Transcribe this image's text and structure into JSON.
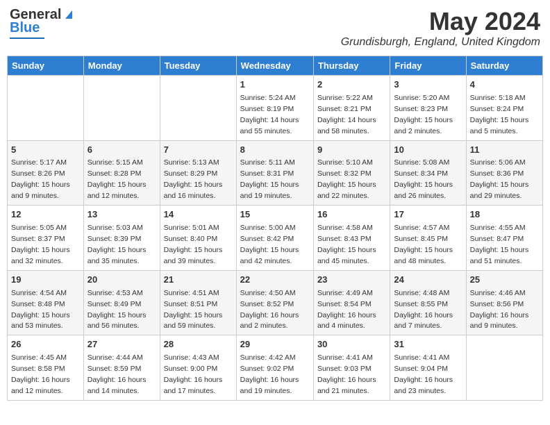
{
  "header": {
    "logo_line1": "General",
    "logo_line2": "Blue",
    "month_year": "May 2024",
    "location": "Grundisburgh, England, United Kingdom"
  },
  "days_of_week": [
    "Sunday",
    "Monday",
    "Tuesday",
    "Wednesday",
    "Thursday",
    "Friday",
    "Saturday"
  ],
  "weeks": [
    [
      {
        "day": "",
        "text": ""
      },
      {
        "day": "",
        "text": ""
      },
      {
        "day": "",
        "text": ""
      },
      {
        "day": "1",
        "text": "Sunrise: 5:24 AM\nSunset: 8:19 PM\nDaylight: 14 hours and 55 minutes."
      },
      {
        "day": "2",
        "text": "Sunrise: 5:22 AM\nSunset: 8:21 PM\nDaylight: 14 hours and 58 minutes."
      },
      {
        "day": "3",
        "text": "Sunrise: 5:20 AM\nSunset: 8:23 PM\nDaylight: 15 hours and 2 minutes."
      },
      {
        "day": "4",
        "text": "Sunrise: 5:18 AM\nSunset: 8:24 PM\nDaylight: 15 hours and 5 minutes."
      }
    ],
    [
      {
        "day": "5",
        "text": "Sunrise: 5:17 AM\nSunset: 8:26 PM\nDaylight: 15 hours and 9 minutes."
      },
      {
        "day": "6",
        "text": "Sunrise: 5:15 AM\nSunset: 8:28 PM\nDaylight: 15 hours and 12 minutes."
      },
      {
        "day": "7",
        "text": "Sunrise: 5:13 AM\nSunset: 8:29 PM\nDaylight: 15 hours and 16 minutes."
      },
      {
        "day": "8",
        "text": "Sunrise: 5:11 AM\nSunset: 8:31 PM\nDaylight: 15 hours and 19 minutes."
      },
      {
        "day": "9",
        "text": "Sunrise: 5:10 AM\nSunset: 8:32 PM\nDaylight: 15 hours and 22 minutes."
      },
      {
        "day": "10",
        "text": "Sunrise: 5:08 AM\nSunset: 8:34 PM\nDaylight: 15 hours and 26 minutes."
      },
      {
        "day": "11",
        "text": "Sunrise: 5:06 AM\nSunset: 8:36 PM\nDaylight: 15 hours and 29 minutes."
      }
    ],
    [
      {
        "day": "12",
        "text": "Sunrise: 5:05 AM\nSunset: 8:37 PM\nDaylight: 15 hours and 32 minutes."
      },
      {
        "day": "13",
        "text": "Sunrise: 5:03 AM\nSunset: 8:39 PM\nDaylight: 15 hours and 35 minutes."
      },
      {
        "day": "14",
        "text": "Sunrise: 5:01 AM\nSunset: 8:40 PM\nDaylight: 15 hours and 39 minutes."
      },
      {
        "day": "15",
        "text": "Sunrise: 5:00 AM\nSunset: 8:42 PM\nDaylight: 15 hours and 42 minutes."
      },
      {
        "day": "16",
        "text": "Sunrise: 4:58 AM\nSunset: 8:43 PM\nDaylight: 15 hours and 45 minutes."
      },
      {
        "day": "17",
        "text": "Sunrise: 4:57 AM\nSunset: 8:45 PM\nDaylight: 15 hours and 48 minutes."
      },
      {
        "day": "18",
        "text": "Sunrise: 4:55 AM\nSunset: 8:47 PM\nDaylight: 15 hours and 51 minutes."
      }
    ],
    [
      {
        "day": "19",
        "text": "Sunrise: 4:54 AM\nSunset: 8:48 PM\nDaylight: 15 hours and 53 minutes."
      },
      {
        "day": "20",
        "text": "Sunrise: 4:53 AM\nSunset: 8:49 PM\nDaylight: 15 hours and 56 minutes."
      },
      {
        "day": "21",
        "text": "Sunrise: 4:51 AM\nSunset: 8:51 PM\nDaylight: 15 hours and 59 minutes."
      },
      {
        "day": "22",
        "text": "Sunrise: 4:50 AM\nSunset: 8:52 PM\nDaylight: 16 hours and 2 minutes."
      },
      {
        "day": "23",
        "text": "Sunrise: 4:49 AM\nSunset: 8:54 PM\nDaylight: 16 hours and 4 minutes."
      },
      {
        "day": "24",
        "text": "Sunrise: 4:48 AM\nSunset: 8:55 PM\nDaylight: 16 hours and 7 minutes."
      },
      {
        "day": "25",
        "text": "Sunrise: 4:46 AM\nSunset: 8:56 PM\nDaylight: 16 hours and 9 minutes."
      }
    ],
    [
      {
        "day": "26",
        "text": "Sunrise: 4:45 AM\nSunset: 8:58 PM\nDaylight: 16 hours and 12 minutes."
      },
      {
        "day": "27",
        "text": "Sunrise: 4:44 AM\nSunset: 8:59 PM\nDaylight: 16 hours and 14 minutes."
      },
      {
        "day": "28",
        "text": "Sunrise: 4:43 AM\nSunset: 9:00 PM\nDaylight: 16 hours and 17 minutes."
      },
      {
        "day": "29",
        "text": "Sunrise: 4:42 AM\nSunset: 9:02 PM\nDaylight: 16 hours and 19 minutes."
      },
      {
        "day": "30",
        "text": "Sunrise: 4:41 AM\nSunset: 9:03 PM\nDaylight: 16 hours and 21 minutes."
      },
      {
        "day": "31",
        "text": "Sunrise: 4:41 AM\nSunset: 9:04 PM\nDaylight: 16 hours and 23 minutes."
      },
      {
        "day": "",
        "text": ""
      }
    ]
  ]
}
